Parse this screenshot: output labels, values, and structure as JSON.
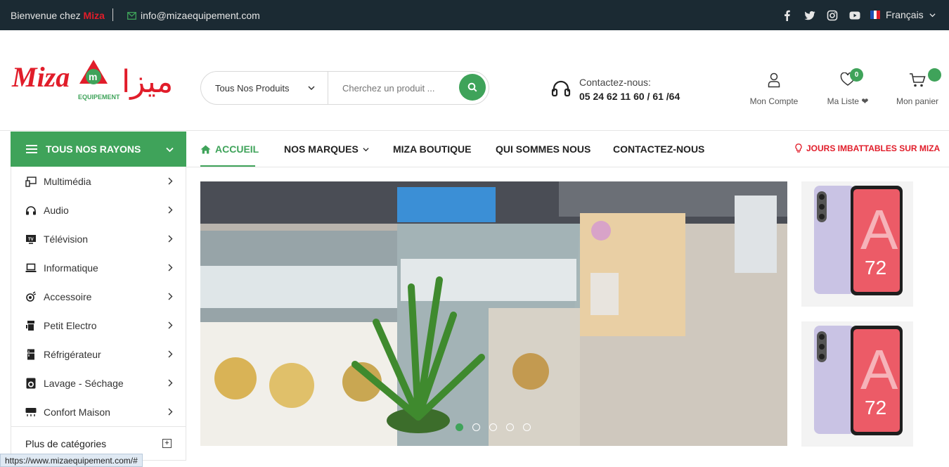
{
  "topbar": {
    "welcome": "Bienvenue chez",
    "brand": "Miza",
    "email": "info@mizaequipement.com",
    "social": [
      "facebook-icon",
      "twitter-icon",
      "instagram-icon",
      "youtube-icon"
    ],
    "language": "Français"
  },
  "logo": {
    "latin": "Miza",
    "sub": "EQUIPEMENT",
    "arabic": "ميزا"
  },
  "search": {
    "category": "Tous Nos Produits",
    "placeholder": "Cherchez un produit ..."
  },
  "contact": {
    "label": "Contactez-nous:",
    "phone": "05 24 62 11 60 / 61 /64"
  },
  "header_actions": {
    "account": "Mon Compte",
    "wishlist": "Ma Liste",
    "wishlist_count": "0",
    "cart": "Mon panier"
  },
  "nav": {
    "rayons": "TOUS NOS RAYONS",
    "items": [
      "ACCUEIL",
      "NOS MARQUES",
      "MIZA BOUTIQUE",
      "QUI SOMMES NOUS",
      "CONTACTEZ-NOUS"
    ],
    "promo": "JOURS IMBATTABLES SUR MIZA"
  },
  "categories": [
    {
      "label": "Multimédia",
      "icon": "multimedia-icon"
    },
    {
      "label": "Audio",
      "icon": "headphones-icon"
    },
    {
      "label": "Télévision",
      "icon": "tv-icon"
    },
    {
      "label": "Informatique",
      "icon": "laptop-icon"
    },
    {
      "label": "Accessoire",
      "icon": "accessory-icon"
    },
    {
      "label": "Petit Electro",
      "icon": "appliance-icon"
    },
    {
      "label": "Réfrigérateur",
      "icon": "fridge-icon"
    },
    {
      "label": "Lavage - Séchage",
      "icon": "washing-machine-icon"
    },
    {
      "label": "Confort Maison",
      "icon": "air-conditioner-icon"
    }
  ],
  "more_categories": "Plus de catégories",
  "slider": {
    "dot_count": 5,
    "active_index": 0
  },
  "side_banners": [
    {
      "model_text": "A",
      "model_number": "72"
    },
    {
      "model_text": "A",
      "model_number": "72"
    }
  ],
  "status_url": "https://www.mizaequipement.com/#",
  "colors": {
    "accent": "#3fa35a",
    "brand_red": "#e11d2a",
    "topbar": "#1b2a33"
  }
}
